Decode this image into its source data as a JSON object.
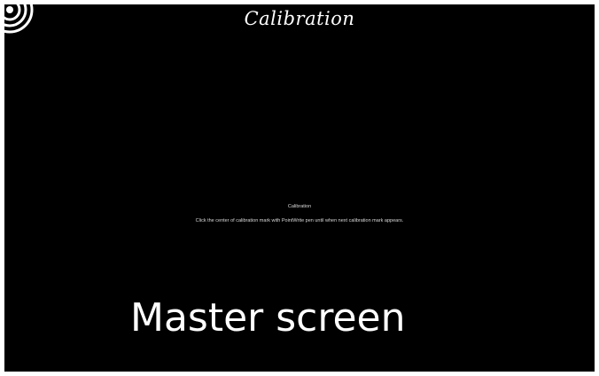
{
  "header": {
    "title": "Calibration"
  },
  "dialog": {
    "title": "Calibration",
    "instruction": "Click the center of calibration mark with PointWrite pen until when next calibration mark appears."
  },
  "caption": {
    "text": "Master screen"
  },
  "calibration_mark": {
    "icon": "calibration-target-icon",
    "color": "#ffffff"
  },
  "colors": {
    "background": "#000000",
    "text": "#ffffff"
  }
}
